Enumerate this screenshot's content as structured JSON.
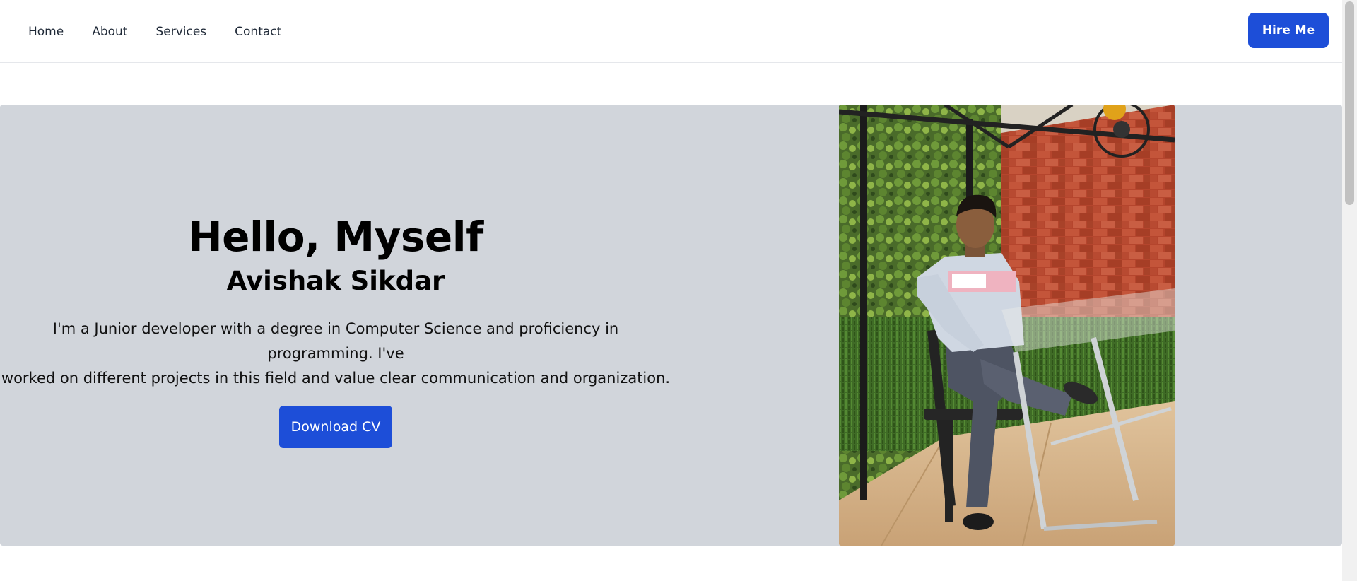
{
  "nav": {
    "links": [
      "Home",
      "About",
      "Services",
      "Contact"
    ],
    "hire_label": "Hire Me"
  },
  "hero": {
    "heading": "Hello, Myself",
    "name": "Avishak Sikdar",
    "bio_line1": "I'm a Junior developer with a degree in Computer Science and proficiency in programming. I've",
    "bio_line2": "worked on different projects in this field and value clear communication and organization.",
    "cv_label": "Download CV"
  },
  "colors": {
    "accent": "#1d4ed8",
    "hero_bg": "#d1d5db"
  }
}
